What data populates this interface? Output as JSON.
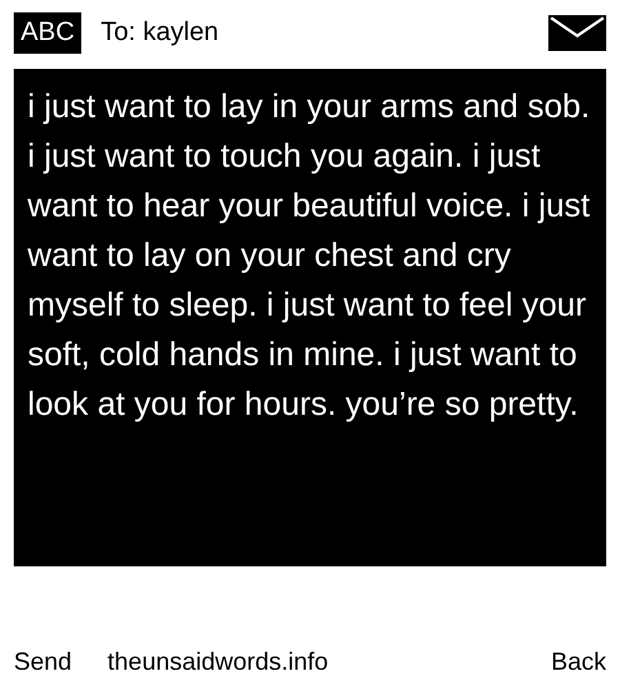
{
  "header": {
    "mode": "ABC",
    "recipient": "To: kaylen"
  },
  "message": "i just want to lay in your arms and sob. i just want to touch you again. i just want to hear your beautiful voice. i just want to lay on your chest and cry myself to sleep. i just want to feel your soft, cold hands in mine. i just want to look at you for hours. you’re so pretty.",
  "footer": {
    "left": "Send",
    "center": "theunsaidwords.info",
    "right": "Back"
  }
}
